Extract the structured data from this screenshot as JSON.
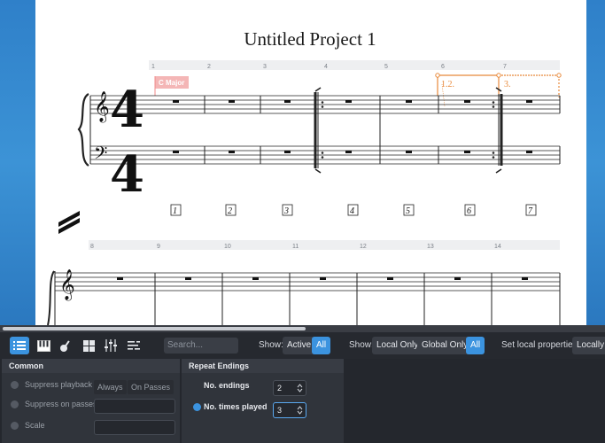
{
  "score": {
    "title": "Untitled Project 1",
    "key_signature": "C Major",
    "time_signature": "4/4",
    "bar_numbers_system1": [
      "1",
      "2",
      "3",
      "4",
      "5",
      "6",
      "7"
    ],
    "bar_numbers_system2": [
      "8",
      "9",
      "10",
      "11",
      "12",
      "13",
      "14"
    ],
    "ending_labels": [
      "1.2.",
      "3."
    ],
    "boxed_numbers": [
      "1",
      "2",
      "3",
      "4",
      "5",
      "6",
      "7"
    ]
  },
  "toolbar": {
    "search_placeholder": "Search...",
    "show_label_1": "Show:",
    "show_active": "Active",
    "show_all_1": "All",
    "show_label_2": "Show:",
    "local_only": "Local Only",
    "global_only": "Global Only",
    "show_all_2": "All",
    "set_local_label": "Set local properties:",
    "set_local_value": "Locally"
  },
  "panels": {
    "common": {
      "title": "Common",
      "suppress_playback": "Suppress playback",
      "always": "Always",
      "on_passes": "On Passes",
      "suppress_on_passes": "Suppress on passes",
      "scale": "Scale"
    },
    "repeat_endings": {
      "title": "Repeat Endings",
      "no_endings_label": "No. endings",
      "no_endings_value": "2",
      "no_times_played_label": "No. times played",
      "no_times_played_value": "3"
    }
  },
  "colors": {
    "accent": "#3b93df",
    "ending_line": "#e8893a",
    "key_flag": "#f4b6b6"
  }
}
